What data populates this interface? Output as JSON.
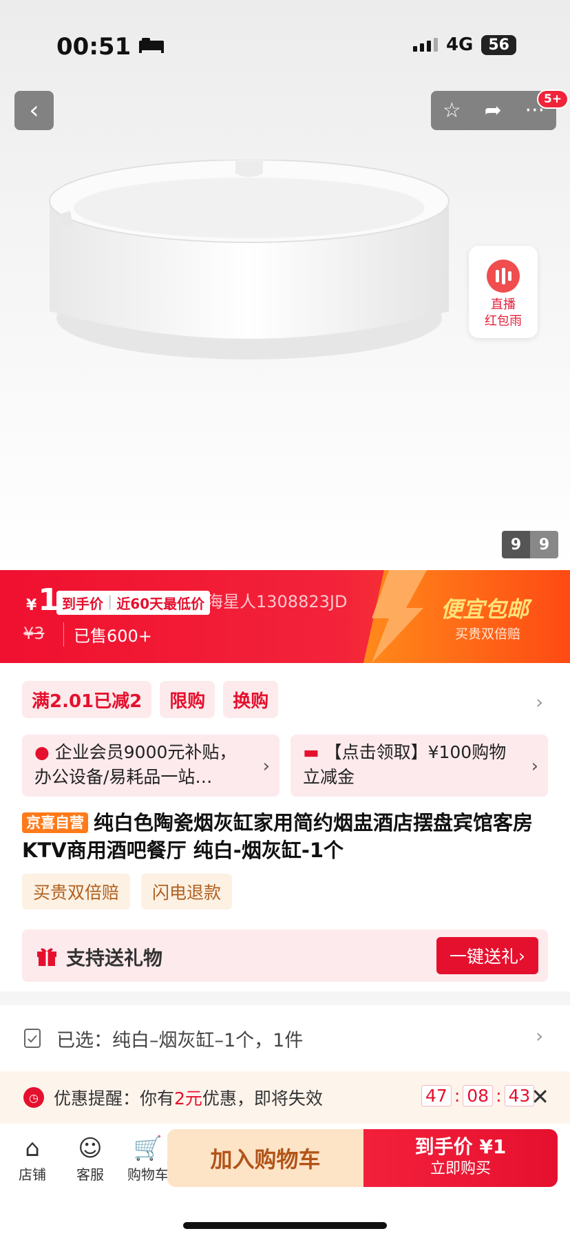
{
  "status_bar": {
    "time": "00:51",
    "network": "4G",
    "battery": "56"
  },
  "top_actions": {
    "back_icon": "chevron-left-icon",
    "notification_badge": "5+"
  },
  "gallery": {
    "current": "9",
    "total": "9"
  },
  "live_float": {
    "line1": "直播",
    "line2": "红包雨"
  },
  "price_banner": {
    "currency": "¥",
    "price": "1",
    "hand_price_label": "到手价",
    "lowest_label": "近60天最低价",
    "ticker": "海星人1308823JD",
    "original_price": "¥3",
    "sold": "已售600+",
    "slogan": "便宜包邮",
    "slogan_sub": "买贵双倍赔"
  },
  "promo_tags": [
    "满2.01已减2",
    "限购",
    "换购"
  ],
  "cards": [
    {
      "text": "企业会员9000元补贴，办公设备/易耗品一站…"
    },
    {
      "text": "【点击领取】¥100购物立减金"
    }
  ],
  "product": {
    "store_tag": "京喜自营",
    "title": "纯白色陶瓷烟灰缸家用简约烟盅酒店摆盘宾馆客房KTV商用酒吧餐厅 纯白-烟灰缸-1个"
  },
  "service_tags": [
    "买贵双倍赔",
    "闪电退款"
  ],
  "gift": {
    "label": "支持送礼物",
    "button": "一键送礼"
  },
  "selected": {
    "prefix": "已选：",
    "value": "纯白–烟灰缸–1个，1件"
  },
  "reminder": {
    "label": "优惠提醒：你有",
    "amount": "2元",
    "suffix": "优惠，即将失效",
    "timer": {
      "h": "47",
      "m": "08",
      "s": "43"
    }
  },
  "bottom_bar": {
    "nav": [
      {
        "label": "店铺",
        "icon": "store-icon"
      },
      {
        "label": "客服",
        "icon": "service-icon"
      },
      {
        "label": "购物车",
        "icon": "cart-icon"
      }
    ],
    "add_to_cart": "加入购物车",
    "buy_line1": "到手价 ¥1",
    "buy_line2": "立即购买"
  },
  "colors": {
    "brand_red": "#e5102e",
    "banner_orange": "#ff5a1f"
  }
}
